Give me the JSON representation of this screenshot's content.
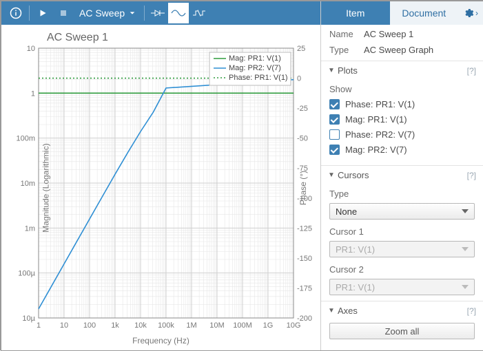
{
  "toolbar": {
    "mode_label": "AC Sweep"
  },
  "chart": {
    "title": "AC Sweep 1",
    "xlabel": "Frequency (Hz)",
    "ylabel_left": "Magnitude (Logarithmic)",
    "ylabel_right": "Phase (°)"
  },
  "legend": {
    "items": [
      {
        "label": "Mag: PR1: V(1)"
      },
      {
        "label": "Mag: PR2: V(7)"
      },
      {
        "label": "Phase: PR1: V(1)"
      }
    ]
  },
  "panel": {
    "tab_item": "Item",
    "tab_doc": "Document",
    "name_k": "Name",
    "name_v": "AC Sweep 1",
    "type_k": "Type",
    "type_v": "AC Sweep Graph",
    "plots_title": "Plots",
    "show_label": "Show",
    "checks": [
      {
        "label": "Phase: PR1: V(1)",
        "checked": true
      },
      {
        "label": "Mag: PR1: V(1)",
        "checked": true
      },
      {
        "label": "Phase: PR2: V(7)",
        "checked": false
      },
      {
        "label": "Mag: PR2: V(7)",
        "checked": true
      }
    ],
    "cursors_title": "Cursors",
    "cursors_type_label": "Type",
    "cursors_type_value": "None",
    "cursor1_label": "Cursor 1",
    "cursor1_value": "PR1: V(1)",
    "cursor2_label": "Cursor 2",
    "cursor2_value": "PR1: V(1)",
    "axes_title": "Axes",
    "zoom_all": "Zoom all",
    "help": "[?]"
  },
  "chart_data": {
    "type": "line",
    "title": "AC Sweep 1",
    "xlabel": "Frequency (Hz)",
    "x_scale": "log",
    "x_ticks": [
      1,
      10,
      100,
      1000,
      10000,
      100000,
      1000000,
      10000000,
      100000000,
      1000000000,
      10000000000
    ],
    "x_tick_labels": [
      "1",
      "10",
      "100",
      "1k",
      "10k",
      "100k",
      "1M",
      "10M",
      "100M",
      "1G",
      "10G"
    ],
    "left_axis": {
      "label": "Magnitude (Logarithmic)",
      "scale": "log",
      "ticks": [
        1e-05,
        0.0001,
        0.001,
        0.01,
        0.1,
        1,
        10
      ],
      "tick_labels": [
        "10µ",
        "100µ",
        "1m",
        "10m",
        "100m",
        "1",
        "10"
      ]
    },
    "right_axis": {
      "label": "Phase (°)",
      "scale": "linear",
      "range": [
        -200,
        25
      ],
      "ticks": [
        25,
        0,
        -25,
        -50,
        -75,
        -100,
        -125,
        -150,
        -175,
        -200
      ]
    },
    "series": [
      {
        "name": "Mag: PR1: V(1)",
        "axis": "left",
        "color": "#2e9b3d",
        "style": "solid",
        "x": [
          1,
          10000000000
        ],
        "y": [
          1,
          1
        ]
      },
      {
        "name": "Mag: PR2: V(7)",
        "axis": "left",
        "color": "#2f8fd4",
        "style": "solid",
        "x": [
          1,
          3,
          10,
          31.6,
          100,
          316,
          1000,
          3160,
          10000,
          10000000000
        ],
        "y": [
          1.59e-05,
          4.77e-05,
          0.000159,
          0.000503,
          0.00159,
          0.00501,
          0.0157,
          0.0479,
          0.125,
          2,
          2,
          2
        ]
      },
      {
        "name": "Phase: PR1: V(1)",
        "axis": "right",
        "color": "#2e9b3d",
        "style": "dotted",
        "x": [
          1,
          10000000000
        ],
        "y": [
          0,
          0
        ]
      }
    ]
  }
}
